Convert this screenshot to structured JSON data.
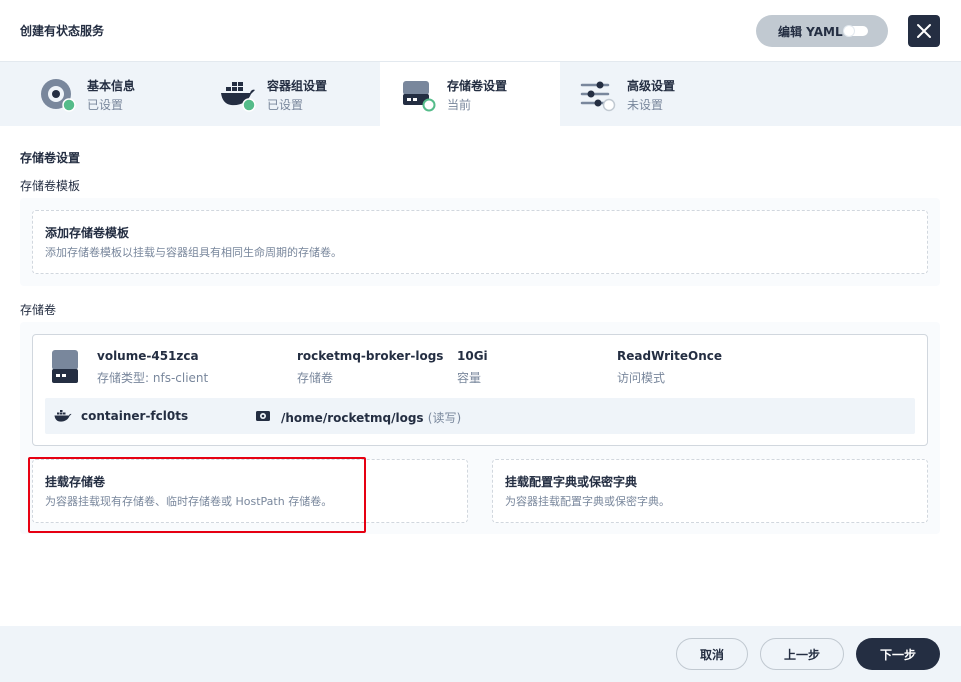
{
  "header": {
    "title": "创建有状态服务",
    "yaml_label": "编辑 YAML"
  },
  "steps": [
    {
      "title": "基本信息",
      "status": "已设置"
    },
    {
      "title": "容器组设置",
      "status": "已设置"
    },
    {
      "title": "存储卷设置",
      "status": "当前"
    },
    {
      "title": "高级设置",
      "status": "未设置"
    }
  ],
  "main": {
    "section_title": "存储卷设置",
    "template_label": "存储卷模板",
    "template_card": {
      "title": "添加存储卷模板",
      "desc": "添加存储卷模板以挂载与容器组具有相同生命周期的存储卷。"
    },
    "volumes_label": "存储卷",
    "volume": {
      "name": "volume-451zca",
      "type_label": "存储类型: nfs-client",
      "claim": "rocketmq-broker-logs",
      "claim_label": "存储卷",
      "capacity": "10Gi",
      "capacity_label": "容量",
      "access_mode": "ReadWriteOnce",
      "access_mode_label": "访问模式",
      "container": "container-fcl0ts",
      "mount_path": "/home/rocketmq/logs",
      "mount_mode": "(读写)"
    },
    "mount_volume_card": {
      "title": "挂载存储卷",
      "desc": "为容器挂载现有存储卷、临时存储卷或 HostPath 存储卷。"
    },
    "mount_config_card": {
      "title": "挂载配置字典或保密字典",
      "desc": "为容器挂载配置字典或保密字典。"
    }
  },
  "footer": {
    "cancel_label": "取消",
    "prev_label": "上一步",
    "next_label": "下一步"
  },
  "colors": {
    "primary_dark": "#242e42",
    "success_green": "#55bc8a",
    "muted_text": "#79879c",
    "highlight_red": "#e60012",
    "bg_light": "#eff4f9"
  }
}
